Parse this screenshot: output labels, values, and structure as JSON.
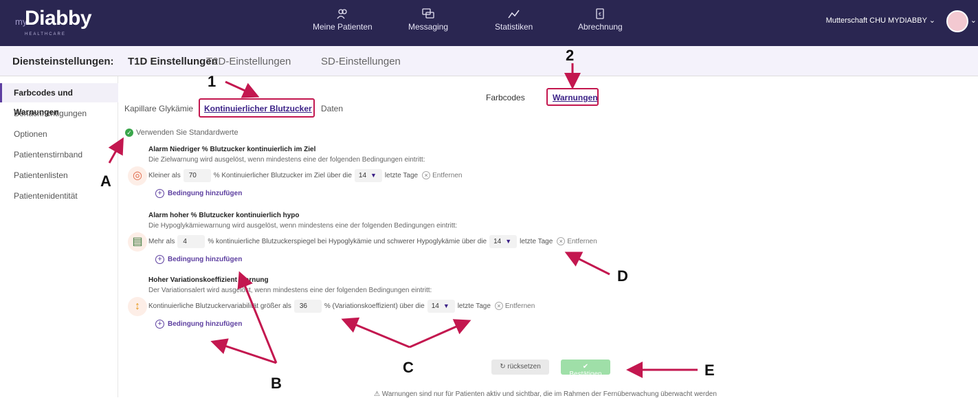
{
  "logo": {
    "prefix": "my",
    "name": "Diabby",
    "sub": "HEALTHCARE"
  },
  "topnav": [
    {
      "label": "Meine Patienten",
      "icon": "patients-icon"
    },
    {
      "label": "Messaging",
      "icon": "messaging-icon"
    },
    {
      "label": "Statistiken",
      "icon": "statistics-icon"
    },
    {
      "label": "Abrechnung",
      "icon": "billing-icon"
    }
  ],
  "user": {
    "name": "Mutterschaft CHU MYDIABBY"
  },
  "subnav": {
    "title": "Diensteinstellungen:",
    "tabs": [
      "T1D Einstellungen",
      "T2D-Einstellungen",
      "SD-Einstellungen"
    ]
  },
  "sidebar": {
    "items": [
      "Farbcodes und Warnungen",
      "Benachrichtigungen",
      "Optionen",
      "Patientenstirnband",
      "Patientenlisten",
      "Patientenidentität"
    ]
  },
  "typetabs": [
    "Kapillare Glykämie",
    "Kontinuierlicher Blutzucker",
    "Daten"
  ],
  "modetabs": [
    "Farbcodes",
    "Warnungen"
  ],
  "defaults_label": "Verwenden Sie Standardwerte",
  "alerts": [
    {
      "title": "Alarm Niedriger % Blutzucker kontinuierlich im Ziel",
      "desc": "Die Zielwarnung wird ausgelöst, wenn mindestens eine der folgenden Bedingungen eintritt:",
      "row_prefix": "Kleiner als",
      "value": "70",
      "row_mid": "% Kontinuierlicher Blutzucker im Ziel über die",
      "days": "14",
      "row_suffix": "letzte Tage",
      "remove": "Entfernen",
      "add": "Bedingung hinzufügen",
      "icon": "target-icon"
    },
    {
      "title": "Alarm hoher % Blutzucker kontinuierlich hypo",
      "desc": "Die Hypoglykämiewarnung wird ausgelöst, wenn mindestens eine der folgenden Bedingungen eintritt:",
      "row_prefix": "Mehr als",
      "value": "4",
      "row_mid": "% kontinuierliche Blutzuckerspiegel bei Hypoglykämie und schwerer Hypoglykämie über die",
      "days": "14",
      "row_suffix": "letzte Tage",
      "remove": "Entfernen",
      "add": "Bedingung hinzufügen",
      "icon": "hypo-chart-icon"
    },
    {
      "title": "Hoher Variationskoeffizient Warnung",
      "desc": "Der Variationsalert wird ausgelöst, wenn mindestens eine der folgenden Bedingungen eintritt:",
      "row_prefix": "Kontinuierliche Blutzuckervariabilität größer als",
      "value": "36",
      "row_mid": "% (Variationskoeffizient) über die",
      "days": "14",
      "row_suffix": "letzte Tage",
      "remove": "Entfernen",
      "add": "Bedingung hinzufügen",
      "icon": "variation-icon"
    }
  ],
  "buttons": {
    "reset": "rücksetzen",
    "confirm": "Bestätigen"
  },
  "footnote": "Warnungen sind nur für Patienten aktiv und sichtbar, die im Rahmen der Fernüberwachung überwacht werden",
  "annotations": [
    "1",
    "2",
    "A",
    "B",
    "C",
    "D",
    "E"
  ],
  "colors": {
    "topbar": "#2a2651",
    "accent": "#5d3fa0",
    "annotation": "#c3174f",
    "confirm": "#9fdfa8"
  }
}
